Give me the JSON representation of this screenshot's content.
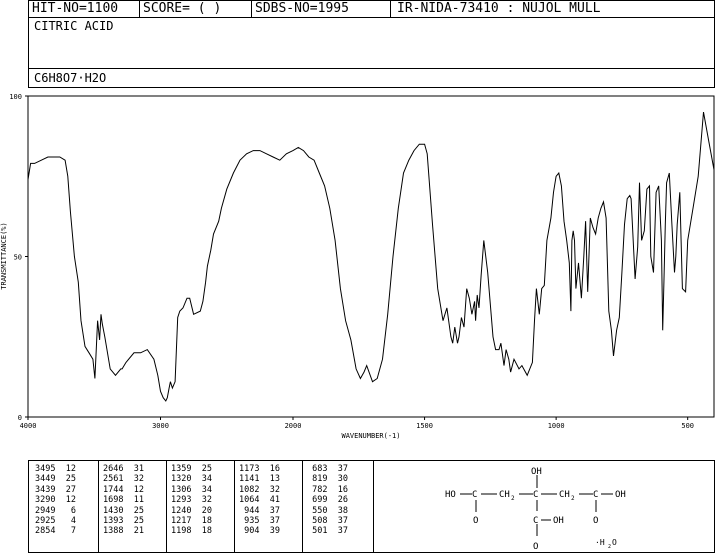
{
  "header": {
    "hit_no": "HIT-NO=1100",
    "score": "SCORE=  (  )",
    "sdbs_no": "SDBS-NO=1995",
    "ir_info": "IR-NIDA-73410 : NUJOL MULL"
  },
  "compound": {
    "name": "CITRIC ACID",
    "formula": "C6H8O7·H2O"
  },
  "chart_data": {
    "type": "line",
    "xlabel": "WAVENUMBER(-1)",
    "ylabel": "TRANSMITTANCE(%)",
    "xlim": [
      4000,
      400
    ],
    "ylim": [
      0,
      100
    ],
    "x_ticks": [
      4000,
      3000,
      2000,
      1500,
      1000,
      500
    ],
    "y_ticks": [
      0,
      50,
      100
    ],
    "x_tick_labels": [
      "4000",
      "3000",
      "2000",
      "1500",
      "1000",
      "500"
    ],
    "y_tick_labels": [
      "0",
      "50",
      "100"
    ],
    "series": [
      {
        "x": [
          4000,
          3980,
          3950,
          3900,
          3850,
          3800,
          3760,
          3720,
          3700,
          3680,
          3650,
          3620,
          3600,
          3570,
          3540,
          3510,
          3495,
          3475,
          3460,
          3449,
          3439,
          3420,
          3380,
          3340,
          3300,
          3290,
          3260,
          3200,
          3150,
          3100,
          3050,
          3020,
          3000,
          2980,
          2960,
          2949,
          2935,
          2925,
          2910,
          2890,
          2870,
          2854,
          2830,
          2800,
          2780,
          2750,
          2700,
          2680,
          2660,
          2646,
          2620,
          2600,
          2561,
          2540,
          2500,
          2450,
          2400,
          2350,
          2300,
          2250,
          2200,
          2150,
          2100,
          2050,
          2000,
          1980,
          1960,
          1940,
          1920,
          1900,
          1880,
          1860,
          1840,
          1820,
          1800,
          1780,
          1760,
          1744,
          1730,
          1720,
          1698,
          1680,
          1660,
          1640,
          1620,
          1600,
          1580,
          1560,
          1540,
          1520,
          1500,
          1490,
          1470,
          1450,
          1430,
          1415,
          1400,
          1393,
          1385,
          1375,
          1369,
          1360,
          1350,
          1340,
          1330,
          1320,
          1310,
          1306,
          1300,
          1293,
          1285,
          1275,
          1260,
          1240,
          1230,
          1217,
          1210,
          1198,
          1190,
          1180,
          1173,
          1160,
          1141,
          1130,
          1110,
          1090,
          1082,
          1075,
          1064,
          1055,
          1045,
          1035,
          1020,
          1010,
          1000,
          990,
          980,
          970,
          960,
          950,
          944,
          940,
          935,
          930,
          925,
          915,
          904,
          895,
          888,
          880,
          870,
          860,
          850,
          840,
          830,
          820,
          810,
          800,
          790,
          782,
          770,
          760,
          750,
          740,
          730,
          720,
          715,
          710,
          700,
          690,
          683,
          675,
          665,
          655,
          645,
          640,
          630,
          620,
          610,
          600,
          595,
          590,
          585,
          580,
          570,
          560,
          550,
          545,
          540,
          530,
          520,
          508,
          500,
          480,
          460,
          440,
          420,
          400
        ],
        "y": [
          74,
          79,
          79,
          80,
          81,
          81,
          81,
          80,
          75,
          64,
          50,
          42,
          30,
          22,
          20,
          18,
          12,
          30,
          24,
          32,
          29,
          25,
          15,
          13,
          15,
          15,
          17,
          20,
          20,
          21,
          18,
          13,
          8,
          6,
          5,
          6,
          9,
          11,
          9,
          11,
          31,
          33,
          34,
          37,
          37,
          32,
          33,
          36,
          42,
          47,
          52,
          57,
          61,
          65,
          71,
          76,
          80,
          82,
          83,
          83,
          82,
          81,
          80,
          82,
          83,
          84,
          83,
          81,
          80,
          76,
          72,
          65,
          55,
          40,
          30,
          24,
          15,
          12,
          14,
          16,
          11,
          12,
          18,
          32,
          50,
          65,
          76,
          80,
          83,
          85,
          85,
          82,
          60,
          40,
          30,
          34,
          25,
          23,
          28,
          23,
          25,
          31,
          28,
          40,
          37,
          32,
          36,
          30,
          38,
          34,
          44,
          55,
          45,
          25,
          21,
          21,
          23,
          16,
          21,
          18,
          14,
          18,
          15,
          16,
          13,
          17,
          30,
          40,
          32,
          40,
          41,
          55,
          62,
          70,
          75,
          76,
          72,
          61,
          55,
          48,
          33,
          55,
          58,
          55,
          40,
          48,
          37,
          50,
          61,
          39,
          62,
          59,
          57,
          62,
          65,
          67,
          62,
          33,
          27,
          19,
          27,
          31,
          45,
          60,
          68,
          69,
          68,
          60,
          43,
          53,
          73,
          55,
          58,
          71,
          72,
          50,
          45,
          70,
          72,
          55,
          27,
          43,
          60,
          73,
          76,
          60,
          45,
          50,
          60,
          70,
          40,
          39,
          55,
          65,
          75,
          95,
          86,
          77
        ]
      }
    ],
    "peaks": [
      [
        3495,
        12
      ],
      [
        3449,
        25
      ],
      [
        3439,
        27
      ],
      [
        3290,
        12
      ],
      [
        2949,
        6
      ],
      [
        2925,
        4
      ],
      [
        2854,
        7
      ],
      [
        2646,
        31
      ],
      [
        2561,
        32
      ],
      [
        1744,
        12
      ],
      [
        1698,
        11
      ],
      [
        1430,
        25
      ],
      [
        1393,
        25
      ],
      [
        1388,
        21
      ],
      [
        1359,
        25
      ],
      [
        1320,
        34
      ],
      [
        1306,
        34
      ],
      [
        1293,
        32
      ],
      [
        1240,
        20
      ],
      [
        1217,
        18
      ],
      [
        1198,
        18
      ],
      [
        1173,
        16
      ],
      [
        1141,
        13
      ],
      [
        1082,
        32
      ],
      [
        1064,
        41
      ],
      [
        944,
        37
      ],
      [
        935,
        37
      ],
      [
        904,
        39
      ],
      [
        683,
        37
      ],
      [
        819,
        30
      ],
      [
        782,
        16
      ],
      [
        699,
        26
      ],
      [
        550,
        38
      ],
      [
        508,
        37
      ],
      [
        501,
        37
      ]
    ]
  },
  "peaks_table": {
    "columns": [
      [
        "3495  12",
        "3449  25",
        "3439  27",
        "3290  12",
        "2949   6",
        "2925   4",
        "2854   7"
      ],
      [
        "2646  31",
        "2561  32",
        "1744  12",
        "1698  11",
        "1430  25",
        "1393  25",
        "1388  21"
      ],
      [
        "1359  25",
        "1320  34",
        "1306  34",
        "1293  32",
        "1240  20",
        "1217  18",
        "1198  18"
      ],
      [
        "1173  16",
        "1141  13",
        "1082  32",
        "1064  41",
        " 944  37",
        " 935  37",
        " 904  39"
      ],
      [
        " 683  37",
        " 819  30",
        " 782  16",
        " 699  26",
        " 550  38",
        " 508  37",
        " 501  37"
      ]
    ]
  },
  "structure": {
    "oh_top": "OH",
    "left_acid": "HO",
    "ch2_left": "CH",
    "ch2_right": "CH",
    "two": "2",
    "c_center": "C",
    "right_oh": "OH",
    "o_left": "O",
    "o_right": "O",
    "o_bottom": "O",
    "c_oh": "OH",
    "c_label": "C",
    "hydrate": "·H",
    "hydrate_o": "O"
  }
}
